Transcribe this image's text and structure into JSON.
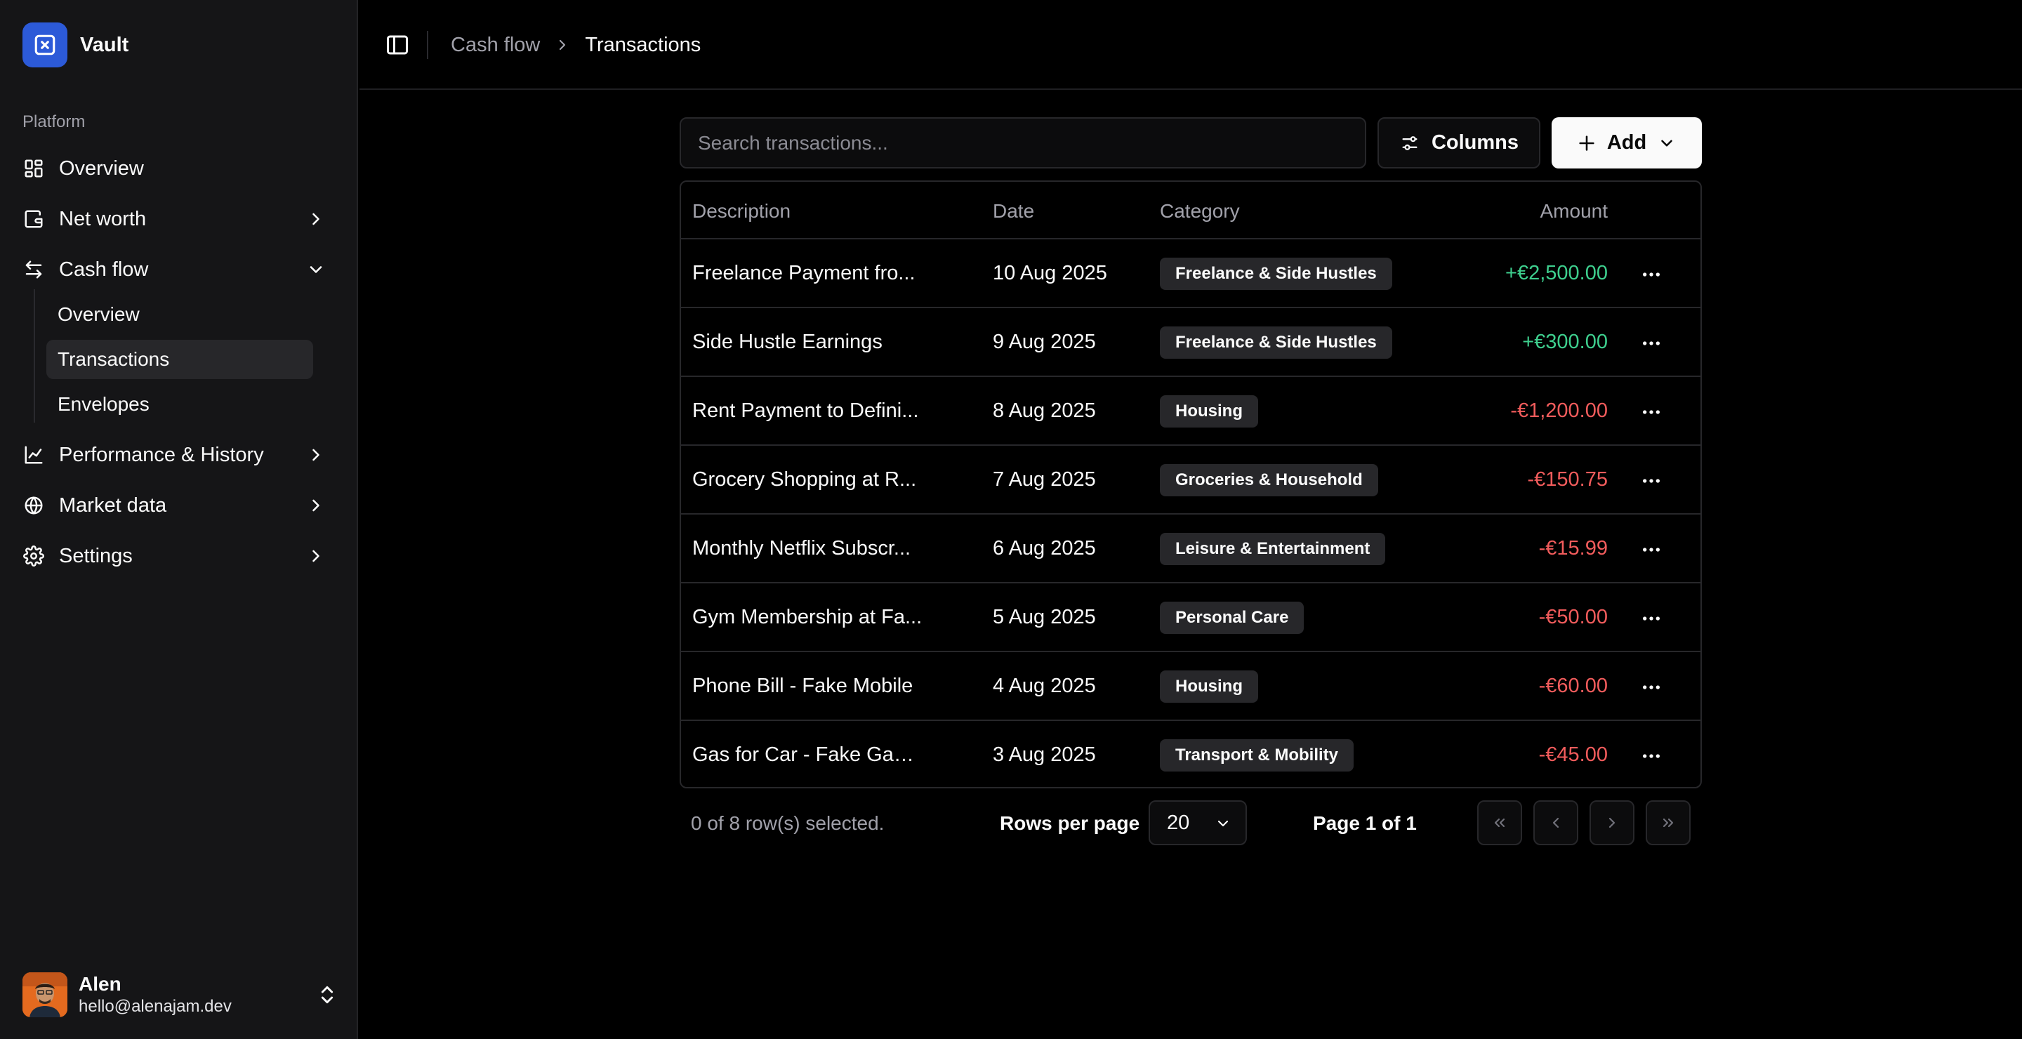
{
  "app": {
    "name": "Vault",
    "logo_icon": "x-square-icon",
    "brand_color": "#2c5ad8"
  },
  "sidebar": {
    "section_label": "Platform",
    "items": [
      {
        "label": "Overview",
        "icon": "layout-grid-icon"
      },
      {
        "label": "Net worth",
        "icon": "wallet-icon"
      },
      {
        "label": "Cash flow",
        "icon": "arrows-left-right-icon"
      },
      {
        "label": "Performance & History",
        "icon": "line-chart-icon"
      },
      {
        "label": "Market data",
        "icon": "globe-icon"
      },
      {
        "label": "Settings",
        "icon": "gear-icon"
      }
    ],
    "cash_flow_sub": [
      {
        "label": "Overview"
      },
      {
        "label": "Transactions",
        "active": true
      },
      {
        "label": "Envelopes"
      }
    ],
    "user": {
      "name": "Alen",
      "email": "hello@alenajam.dev"
    }
  },
  "header": {
    "breadcrumb_parent": "Cash flow",
    "breadcrumb_current": "Transactions"
  },
  "toolbar": {
    "search_placeholder": "Search transactions...",
    "columns_label": "Columns",
    "add_label": "Add"
  },
  "table": {
    "columns": {
      "description": "Description",
      "date": "Date",
      "category": "Category",
      "amount": "Amount"
    },
    "rows": [
      {
        "description": "Freelance Payment fro...",
        "date": "10 Aug 2025",
        "category": "Freelance & Side Hustles",
        "amount": "+€2,500.00",
        "sign": "positive"
      },
      {
        "description": "Side Hustle Earnings",
        "date": "9 Aug 2025",
        "category": "Freelance & Side Hustles",
        "amount": "+€300.00",
        "sign": "positive"
      },
      {
        "description": "Rent Payment to Defini...",
        "date": "8 Aug 2025",
        "category": "Housing",
        "amount": "-€1,200.00",
        "sign": "negative"
      },
      {
        "description": "Grocery Shopping at R...",
        "date": "7 Aug 2025",
        "category": "Groceries & Household",
        "amount": "-€150.75",
        "sign": "negative"
      },
      {
        "description": "Monthly Netflix Subscr...",
        "date": "6 Aug 2025",
        "category": "Leisure & Entertainment",
        "amount": "-€15.99",
        "sign": "negative"
      },
      {
        "description": "Gym Membership at Fa...",
        "date": "5 Aug 2025",
        "category": "Personal Care",
        "amount": "-€50.00",
        "sign": "negative"
      },
      {
        "description": "Phone Bill - Fake Mobile",
        "date": "4 Aug 2025",
        "category": "Housing",
        "amount": "-€60.00",
        "sign": "negative"
      },
      {
        "description": "Gas for Car - Fake Gas ...",
        "date": "3 Aug 2025",
        "category": "Transport & Mobility",
        "amount": "-€45.00",
        "sign": "negative"
      }
    ]
  },
  "pagination": {
    "selected_text": "0 of 8 row(s) selected.",
    "rows_per_page_label": "Rows per page",
    "rows_per_page_value": "20",
    "page_text": "Page 1 of 1"
  },
  "colors": {
    "positive": "#3ecf8e",
    "negative": "#f25c5c",
    "sidebar_bg": "#151517",
    "page_bg": "#000000"
  }
}
